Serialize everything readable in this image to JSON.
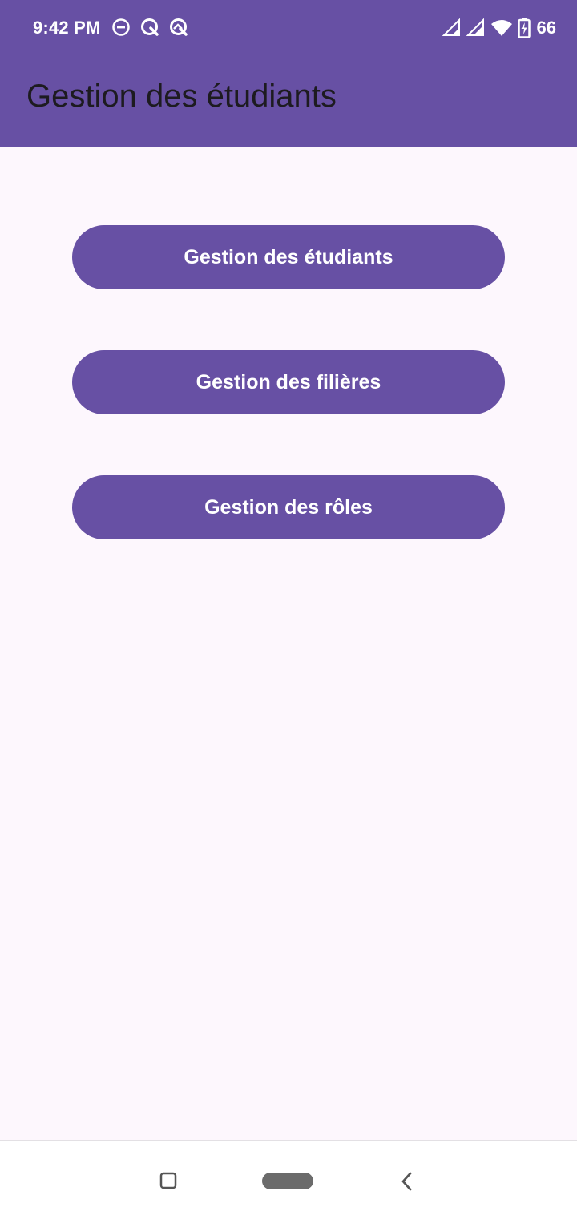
{
  "status_bar": {
    "time": "9:42 PM",
    "left_icons": [
      "do-not-disturb-icon",
      "quick-notification-icon",
      "quick-notification-icon"
    ],
    "right_icons": [
      "signal-icon",
      "signal-icon",
      "wifi-icon",
      "battery-charging-icon"
    ],
    "battery_level": "66"
  },
  "app_bar": {
    "title": "Gestion des étudiants"
  },
  "menu": {
    "buttons": [
      {
        "label": "Gestion des étudiants"
      },
      {
        "label": "Gestion des filières"
      },
      {
        "label": "Gestion des rôles"
      }
    ]
  },
  "nav_bar": {
    "icons": [
      "recents-icon",
      "home-pill-icon",
      "back-icon"
    ]
  },
  "colors": {
    "primary": "#6750a4",
    "background": "#fdf7fd",
    "on_primary": "#ffffff",
    "title_text": "#1d1b20"
  }
}
